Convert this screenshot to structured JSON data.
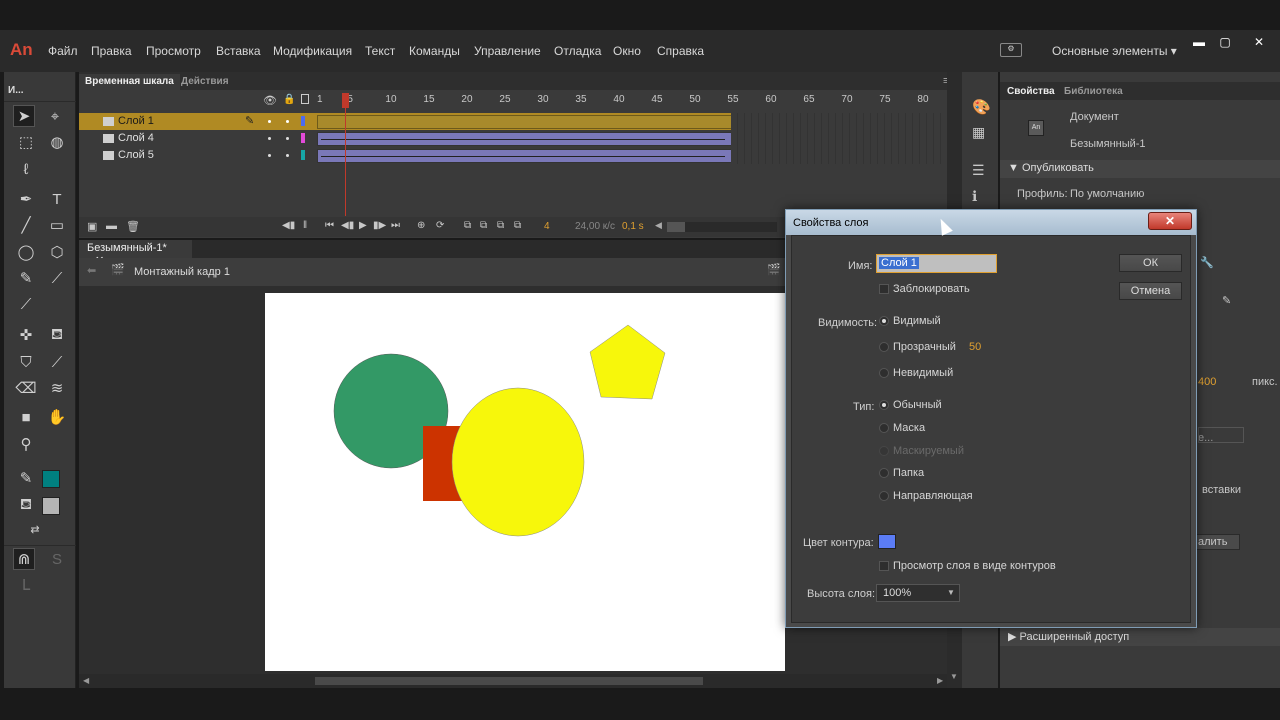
{
  "app": {
    "logo": "An"
  },
  "menu": [
    "Файл",
    "Правка",
    "Просмотр",
    "Вставка",
    "Модификация",
    "Текст",
    "Команды",
    "Управление",
    "Отладка",
    "Окно",
    "Справка"
  ],
  "workspace": {
    "label": "Основные элементы ▾"
  },
  "window_buttons": {
    "minimize": "▬",
    "maximize": "▢",
    "close": "✕"
  },
  "toolbar": {
    "title": "И..."
  },
  "timeline": {
    "tab_timeline": "Временная шкала",
    "tab_actions": "Действия",
    "ruler": [
      "1",
      "5",
      "10",
      "15",
      "20",
      "25",
      "30",
      "35",
      "40",
      "45",
      "50",
      "55",
      "60",
      "65",
      "70",
      "75",
      "80"
    ],
    "layers": [
      {
        "name": "Слой 1",
        "color": "#4d6bf0",
        "selected": true
      },
      {
        "name": "Слой 4",
        "color": "#e24ad9",
        "selected": false
      },
      {
        "name": "Слой 5",
        "color": "#17a7a7",
        "selected": false
      }
    ],
    "current_frame": "4",
    "fps": "24,00 к/с",
    "time": "0,1 s"
  },
  "document": {
    "tab": "Безымянный-1*",
    "tab_close": "✕",
    "scene": "Монтажный кадр 1"
  },
  "stage": {
    "background": "#ffffff",
    "shapes": [
      {
        "kind": "circle",
        "color": "#339966"
      },
      {
        "kind": "rect",
        "color": "#cc3300"
      },
      {
        "kind": "ellipse",
        "color": "#f7f70b"
      },
      {
        "kind": "pentagon",
        "color": "#f7f70b"
      }
    ]
  },
  "properties": {
    "tab_properties": "Свойства",
    "tab_library": "Библиотека",
    "doc_type": "Документ",
    "doc_name": "Безымянный-1",
    "section_publish": "Опубликовать",
    "profile_label": "Профиль:",
    "profile_value": "По умолчанию",
    "size_partial": "400",
    "unit": "пикс.",
    "insert_partial": "вставки",
    "delete_partial": "алить",
    "ellipsis_partial": "е...",
    "section_advanced": "Расширенный доступ"
  },
  "dialog": {
    "title": "Свойства слоя",
    "close": "✕",
    "name_label": "Имя:",
    "name_value": "Слой 1",
    "lock_label": "Заблокировать",
    "ok": "ОК",
    "cancel": "Отмена",
    "visibility_label": "Видимость:",
    "vis_visible": "Видимый",
    "vis_transparent": "Прозрачный",
    "transparency_value": "50",
    "vis_invisible": "Невидимый",
    "type_label": "Тип:",
    "type_normal": "Обычный",
    "type_mask": "Маска",
    "type_masked": "Маскируемый",
    "type_folder": "Папка",
    "type_guide": "Направляющая",
    "outline_color_label": "Цвет контура:",
    "outline_color": "#5b7cf5",
    "view_outlines_label": "Просмотр слоя в виде контуров",
    "height_label": "Высота слоя:",
    "height_value": "100%"
  }
}
